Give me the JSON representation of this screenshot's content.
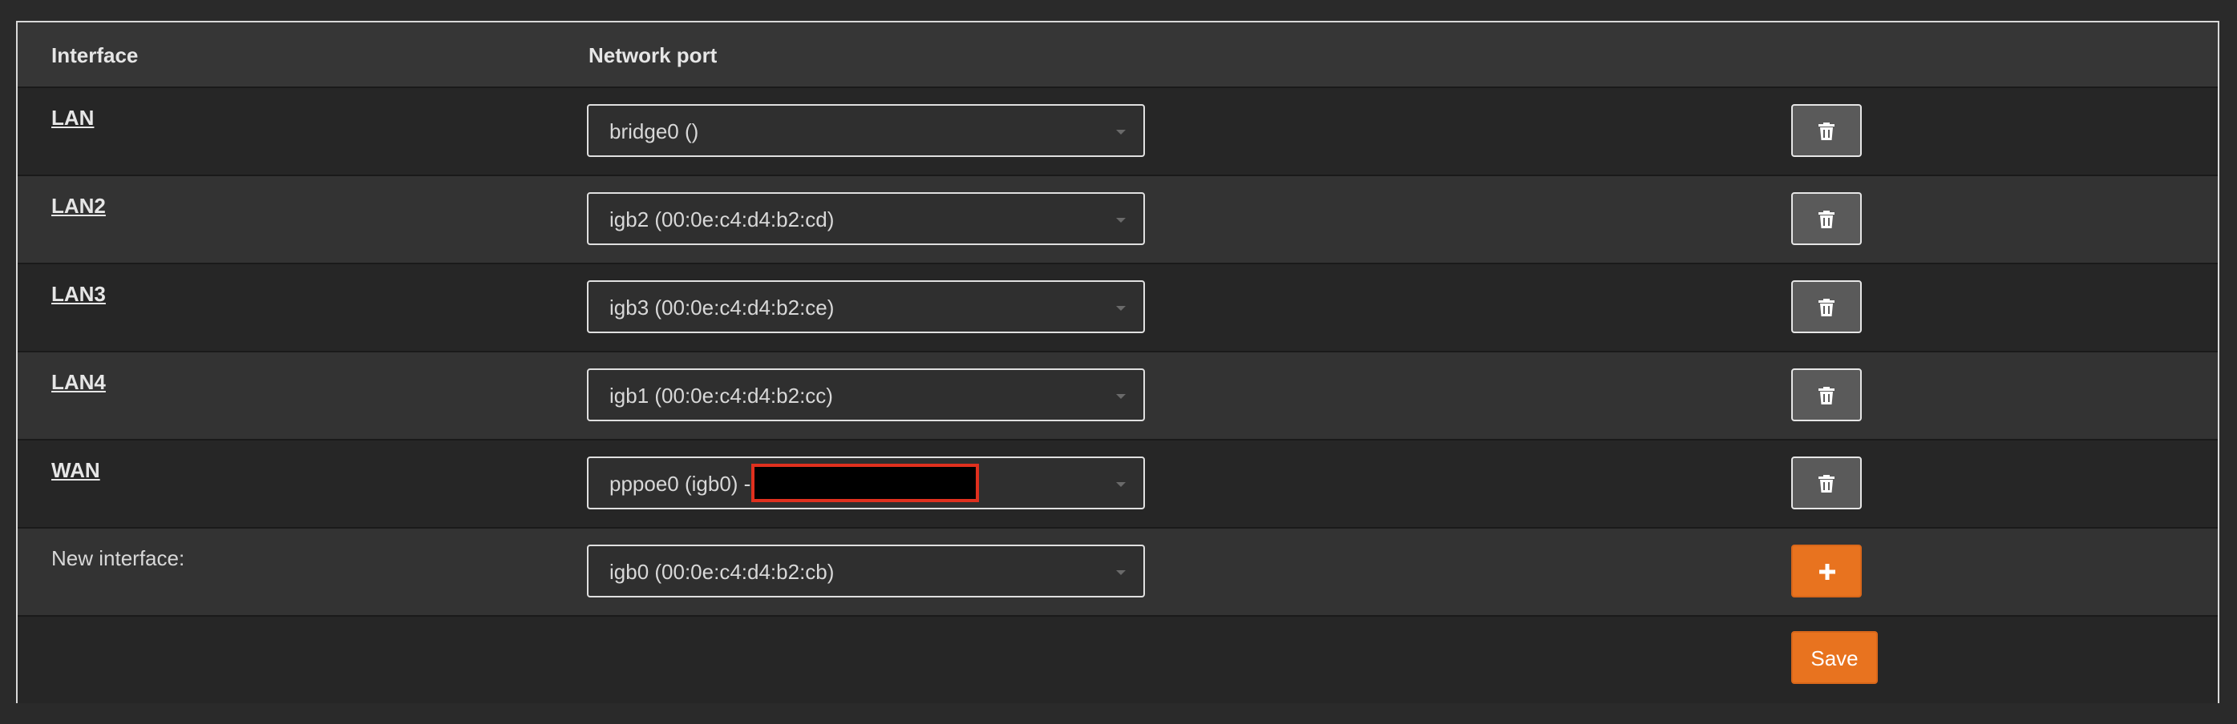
{
  "table": {
    "headers": {
      "interface": "Interface",
      "network_port": "Network port"
    },
    "rows": [
      {
        "name": "LAN",
        "port": "bridge0 ()"
      },
      {
        "name": "LAN2",
        "port": "igb2 (00:0e:c4:d4:b2:cd)"
      },
      {
        "name": "LAN3",
        "port": "igb3 (00:0e:c4:d4:b2:ce)"
      },
      {
        "name": "LAN4",
        "port": "igb1 (00:0e:c4:d4:b2:cc)"
      },
      {
        "name": "WAN",
        "port": "pppoe0 (igb0) -"
      }
    ],
    "new_interface": {
      "label": "New interface:",
      "port": "igb0 (00:0e:c4:d4:b2:cb)"
    }
  },
  "actions": {
    "save_label": "Save"
  },
  "icons": {
    "delete": "trash-icon",
    "add": "plus-icon"
  },
  "colors": {
    "accent": "#e8731f",
    "redaction_border": "#e0301e"
  }
}
